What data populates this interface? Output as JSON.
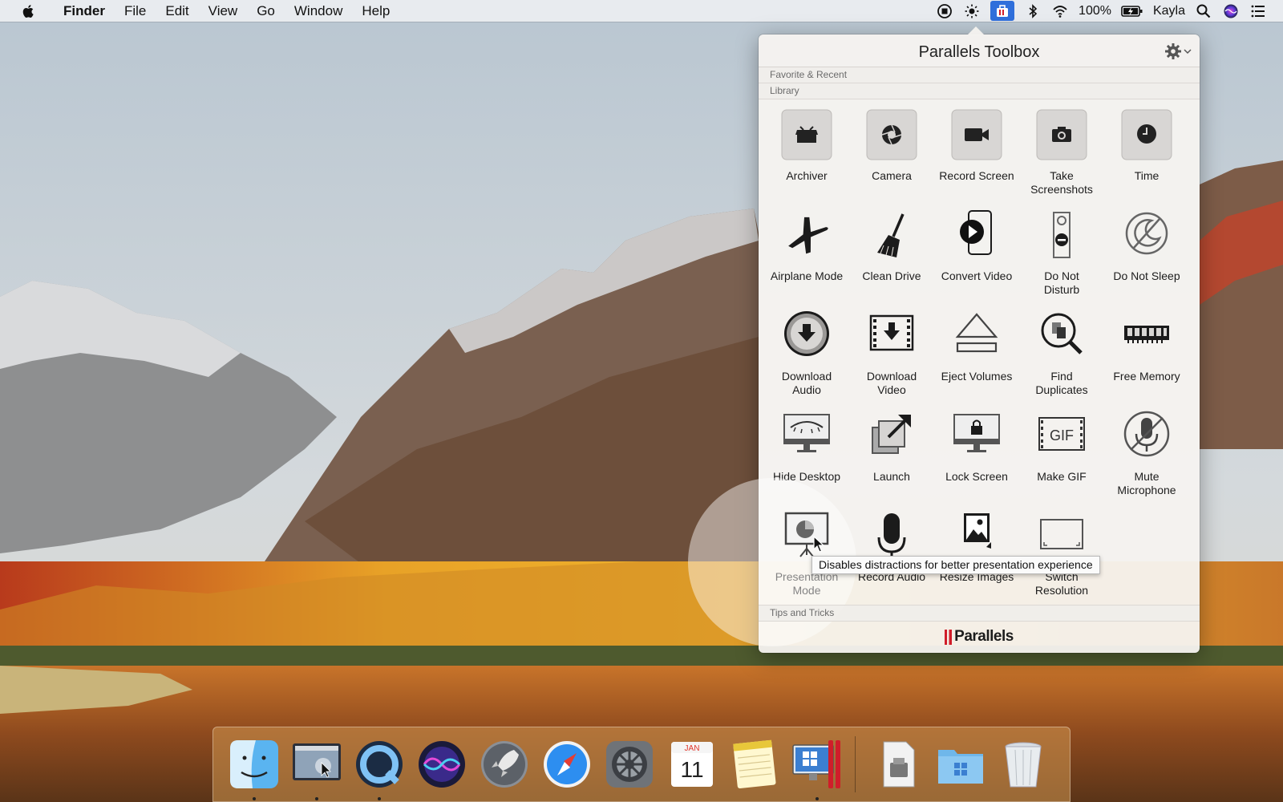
{
  "menubar": {
    "app_name": "Finder",
    "menus": [
      "File",
      "Edit",
      "View",
      "Go",
      "Window",
      "Help"
    ],
    "battery": "100%",
    "user": "Kayla"
  },
  "toolbox": {
    "title": "Parallels Toolbox",
    "sections": {
      "favorites": "Favorite & Recent",
      "library": "Library",
      "tips": "Tips and Tricks"
    },
    "tools": [
      {
        "label": "Archiver",
        "icon": "archiver-icon"
      },
      {
        "label": "Camera",
        "icon": "camera-shutter-icon"
      },
      {
        "label": "Record Screen",
        "icon": "video-camera-icon"
      },
      {
        "label": "Take\nScreenshots",
        "icon": "photo-camera-icon"
      },
      {
        "label": "Time",
        "icon": "clock-icon"
      },
      {
        "label": "Airplane Mode",
        "icon": "airplane-icon"
      },
      {
        "label": "Clean Drive",
        "icon": "broom-icon"
      },
      {
        "label": "Convert Video",
        "icon": "phone-play-icon"
      },
      {
        "label": "Do Not\nDisturb",
        "icon": "door-hanger-icon"
      },
      {
        "label": "Do Not Sleep",
        "icon": "moon-slash-icon"
      },
      {
        "label": "Download\nAudio",
        "icon": "download-circle-icon"
      },
      {
        "label": "Download\nVideo",
        "icon": "film-download-icon"
      },
      {
        "label": "Eject Volumes",
        "icon": "eject-icon"
      },
      {
        "label": "Find\nDuplicates",
        "icon": "magnifier-duplicates-icon"
      },
      {
        "label": "Free Memory",
        "icon": "memory-chip-icon"
      },
      {
        "label": "Hide Desktop",
        "icon": "monitor-eye-icon"
      },
      {
        "label": "Launch",
        "icon": "launch-arrow-icon"
      },
      {
        "label": "Lock Screen",
        "icon": "monitor-lock-icon"
      },
      {
        "label": "Make GIF",
        "icon": "gif-film-icon"
      },
      {
        "label": "Mute\nMicrophone",
        "icon": "microphone-muted-icon"
      },
      {
        "label": "Presentation\nMode",
        "icon": "presentation-icon"
      },
      {
        "label": "Record Audio",
        "icon": "microphone-icon"
      },
      {
        "label": "Resize Images",
        "icon": "image-resize-icon"
      },
      {
        "label": "Switch\nResolution",
        "icon": "resolution-icon"
      }
    ],
    "tooltip": "Disables distractions for better presentation experience",
    "brand": "Parallels"
  },
  "dock": {
    "calendar_month": "JAN",
    "calendar_day": "11"
  },
  "colors": {
    "accent": "#2f6fdb",
    "brand_red": "#d01d2a"
  }
}
